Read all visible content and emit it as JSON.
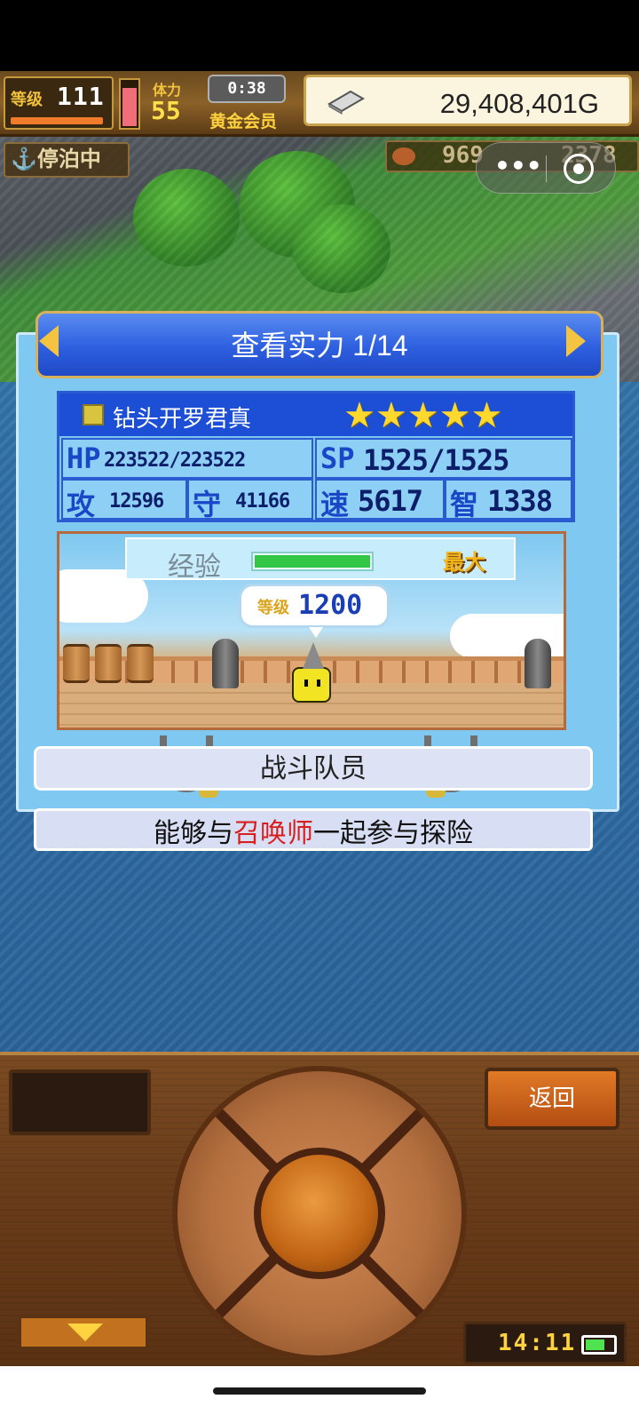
{
  "hud": {
    "level_label": "等级",
    "level_value": "111",
    "hp_ratio": 0.85,
    "stamina_label": "体力",
    "stamina_value": "55",
    "timer": "0:38",
    "membership": "黄金会员",
    "money": "29,408,401G",
    "dock_status": "停泊中",
    "resource_a": "969",
    "resource_b": "2378"
  },
  "dialog": {
    "title": "查看实力 1/14",
    "character_name": "钻头开罗君真",
    "stars": "★★★★★",
    "star_count": 5,
    "stats": {
      "hp_label": "HP",
      "hp": "223522/223522",
      "sp_label": "SP",
      "sp": "1525/1525",
      "atk_label": "攻",
      "atk": "12596",
      "def_label": "守",
      "def": "41166",
      "spd_label": "速",
      "spd": "5617",
      "int_label": "智",
      "int": "1338"
    },
    "exp_label": "经验",
    "exp_ratio": 1.0,
    "exp_max": "最大",
    "level_tag": "等级",
    "level_value": "1200",
    "section_label": "战斗队员",
    "info_prefix": "能够与",
    "info_highlight": "召唤师",
    "info_suffix": "一起参与探险"
  },
  "controller": {
    "back_label": "返回",
    "clock": "14:11",
    "battery_ratio": 0.7
  },
  "colors": {
    "title_blue": "#2d5fe0",
    "panel_blue": "#7ec8f2",
    "gold": "#ffd23f",
    "highlight_red": "#d81f1f",
    "wood": "#6a3d1a"
  }
}
